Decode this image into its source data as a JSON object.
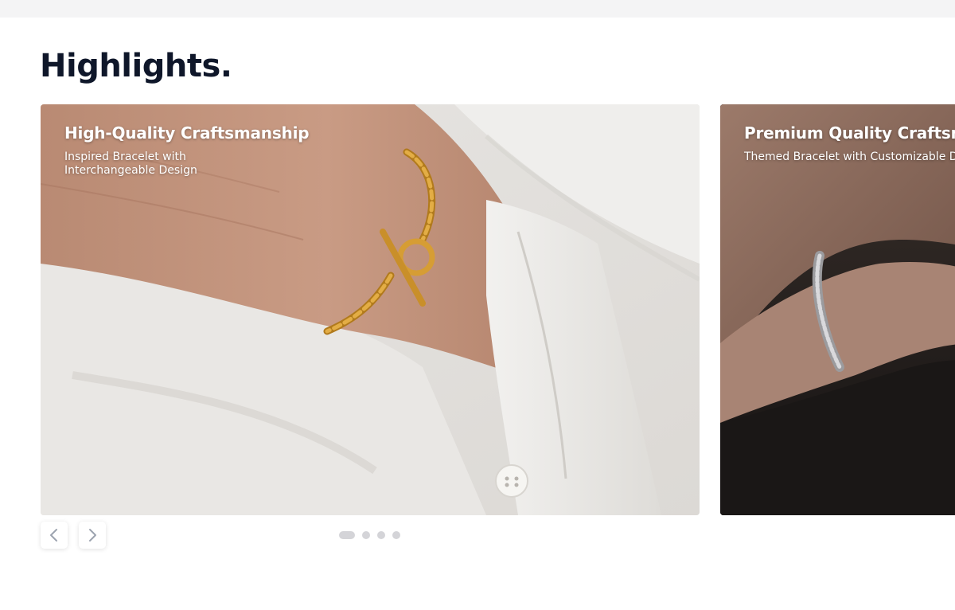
{
  "section": {
    "title": "Highlights."
  },
  "slides": [
    {
      "title": "High-Quality Craftsmanship",
      "subtitle": "Inspired Bracelet with Interchangeable Design"
    },
    {
      "title": "Premium Quality Craftsmanship",
      "subtitle": "Themed Bracelet with Customizable Design"
    }
  ],
  "navigation": {
    "prev_icon": "chevron-left-icon",
    "next_icon": "chevron-right-icon",
    "dots_count": 4,
    "active_dot": 0
  },
  "colors": {
    "title": "#0f172a",
    "slide_text": "#ffffff",
    "dot": "#d4d4d8",
    "topbar": "#f4f4f5"
  }
}
